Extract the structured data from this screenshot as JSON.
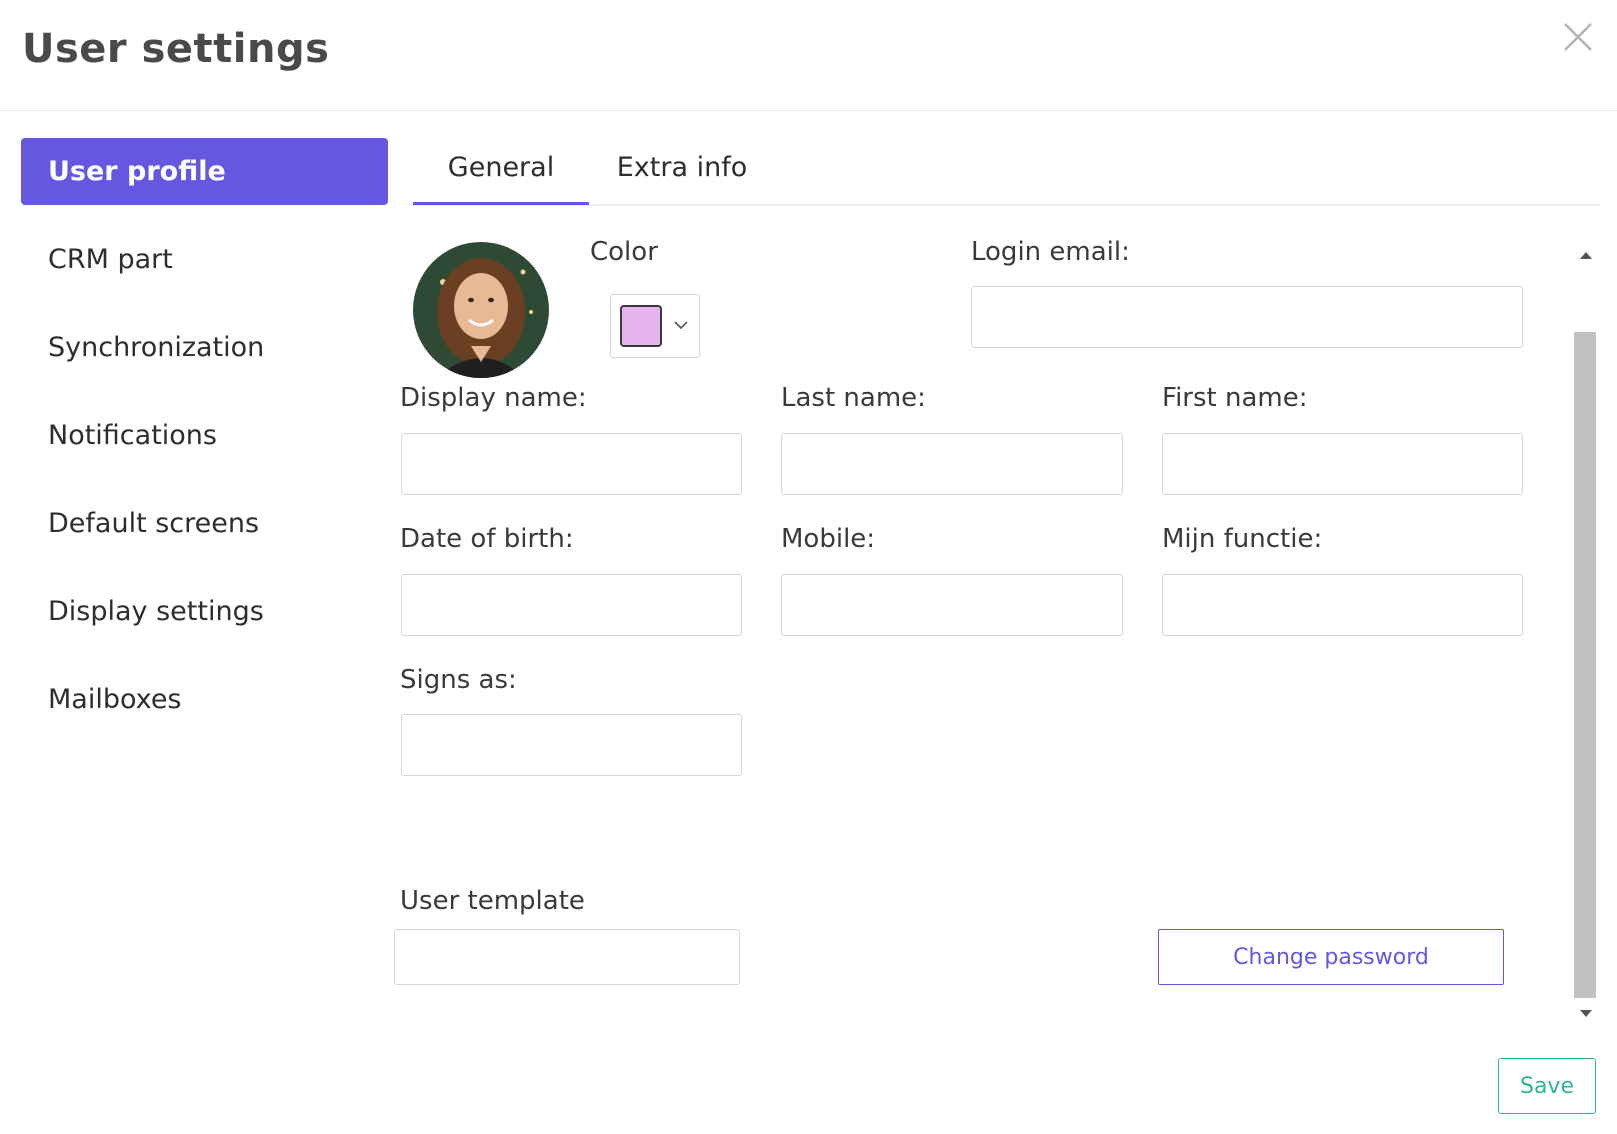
{
  "dialog": {
    "title": "User settings",
    "close_icon": "close-icon"
  },
  "sidebar": {
    "items": [
      {
        "label": "User profile",
        "active": true
      },
      {
        "label": "CRM part"
      },
      {
        "label": "Synchronization"
      },
      {
        "label": "Notifications"
      },
      {
        "label": "Default screens"
      },
      {
        "label": "Display settings"
      },
      {
        "label": "Mailboxes"
      }
    ]
  },
  "tabs": [
    {
      "label": "General",
      "active": true
    },
    {
      "label": "Extra info"
    }
  ],
  "profile": {
    "avatar_icon": "user-avatar-photo",
    "color_label": "Color",
    "color_value": "#e6b3f1",
    "color_chevron_icon": "chevron-down-icon",
    "login_email_label": "Login email:",
    "login_email_value": "",
    "display_name_label": "Display name:",
    "display_name_value": "",
    "last_name_label": "Last name:",
    "last_name_value": "",
    "first_name_label": "First name:",
    "first_name_value": "",
    "date_of_birth_label": "Date of birth:",
    "date_of_birth_value": "",
    "mobile_label": "Mobile:",
    "mobile_value": "",
    "function_label": "Mijn functie:",
    "function_value": "",
    "signs_as_label": "Signs as:",
    "signs_as_value": "",
    "user_template_label": "User template",
    "user_template_value": ""
  },
  "actions": {
    "change_password_label": "Change password",
    "save_label": "Save"
  },
  "colors": {
    "accent": "#6657e0",
    "save": "#2bb59a"
  }
}
